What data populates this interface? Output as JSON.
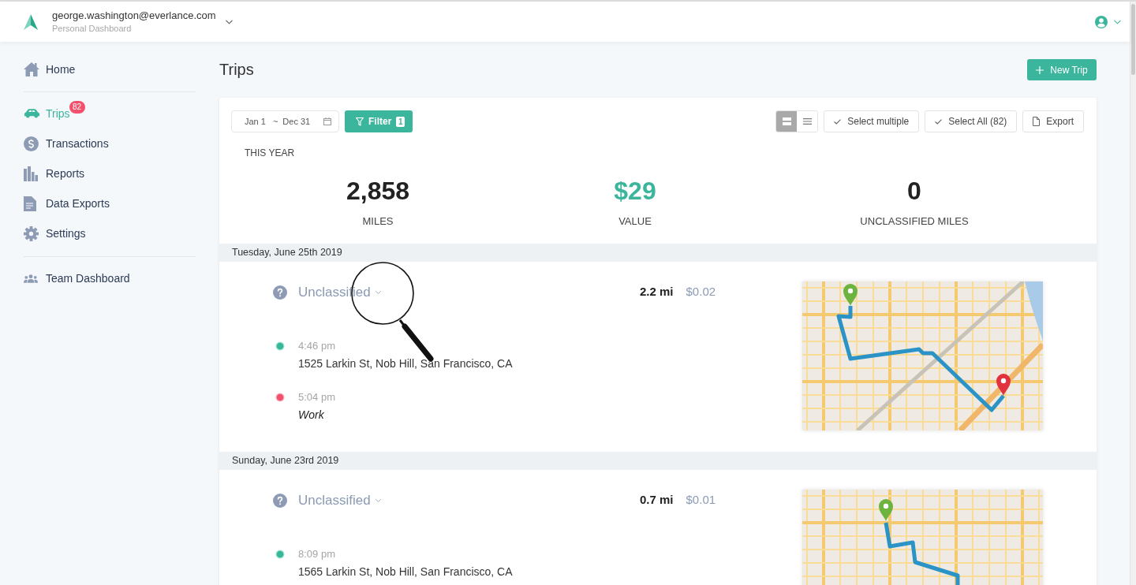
{
  "header": {
    "account_email": "george.washington@everlance.com",
    "account_subtitle": "Personal Dashboard"
  },
  "sidebar": {
    "sections": [
      {
        "items": [
          {
            "label": "Home",
            "selected": false
          }
        ]
      },
      {
        "items": [
          {
            "label": "Trips",
            "selected": true,
            "badge": "82"
          },
          {
            "label": "Transactions",
            "selected": false
          },
          {
            "label": "Reports",
            "selected": false
          },
          {
            "label": "Data Exports",
            "selected": false
          },
          {
            "label": "Settings",
            "selected": false
          }
        ]
      },
      {
        "items": [
          {
            "label": "Team Dashboard",
            "selected": false
          }
        ]
      }
    ]
  },
  "page": {
    "title": "Trips",
    "new_trip_button": "New Trip"
  },
  "toolbar": {
    "date_range": {
      "from": "Jan 1",
      "separator": "~",
      "to": "Dec 31"
    },
    "filter": {
      "label": "Filter",
      "count": "1"
    },
    "view_modes": [
      {
        "kind": "cards",
        "selected": true
      },
      {
        "kind": "list",
        "selected": false
      }
    ],
    "actions": [
      {
        "kind": "select",
        "label": "Select multiple"
      },
      {
        "kind": "select",
        "label": "Select All (82)"
      },
      {
        "kind": "export",
        "label": "Export"
      }
    ]
  },
  "summary": {
    "period": "THIS YEAR",
    "stats": [
      {
        "value": "2,858",
        "label": "MILES",
        "kind": "plain"
      },
      {
        "value": "$29",
        "label": "VALUE",
        "kind": "accent"
      },
      {
        "value": "0",
        "label": "UNCLASSIFIED MILES",
        "kind": "plain"
      }
    ]
  },
  "trip_groups": [
    {
      "date": "Tuesday, June 25th 2019",
      "trips": [
        {
          "classification": "Unclassified",
          "distance": "2.2 mi",
          "value": "$0.02",
          "stops": [
            {
              "kind": "start",
              "time": "4:46 pm",
              "place": "1525 Larkin St, Nob Hill, San Francisco, CA",
              "saved_place": false
            },
            {
              "kind": "end",
              "time": "5:04 pm",
              "place": "Work",
              "saved_place": true
            }
          ]
        }
      ]
    },
    {
      "date": "Sunday, June 23rd 2019",
      "trips": [
        {
          "classification": "Unclassified",
          "distance": "0.7 mi",
          "value": "$0.01",
          "stops": [
            {
              "kind": "start",
              "time": "8:09 pm",
              "place": "1565 Larkin St, Nob Hill, San Francisco, CA",
              "saved_place": false
            }
          ]
        }
      ]
    }
  ]
}
